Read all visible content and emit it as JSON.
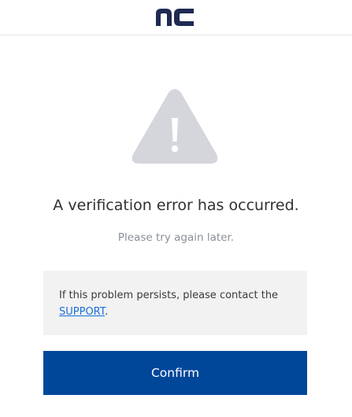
{
  "header": {
    "logo_text": "nc",
    "logo_icon": "nc-logo-icon",
    "brand_color": "#1e2a52"
  },
  "main": {
    "alert_icon": "warning-triangle-icon",
    "title": "A verification error has occurred.",
    "subtitle": "Please try again later.",
    "notice": {
      "text_before": "If this problem persists, please contact the ",
      "link_label": "SUPPORT",
      "text_after": "."
    },
    "confirm_label": "Confirm"
  },
  "colors": {
    "accent": "#00479a",
    "link": "#1a6fd9",
    "icon_gray": "#d4d6dc",
    "notice_bg": "#f2f2f2"
  }
}
